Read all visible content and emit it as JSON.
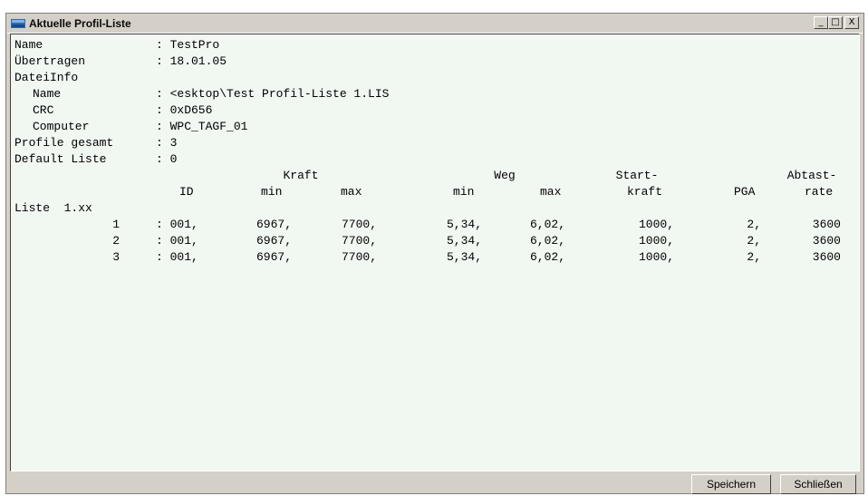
{
  "window": {
    "title": "Aktuelle Profil-Liste",
    "minimize": "_",
    "maximize": "□",
    "close": "X"
  },
  "info": {
    "name_label": "Name",
    "name_value": ": TestPro",
    "transfer_label": "Übertragen",
    "transfer_value": ": 18.01.05",
    "fileinfo_label": "DateiInfo",
    "file_name_label": "Name",
    "file_name_value": ": <esktop\\Test Profil-Liste 1.LIS",
    "crc_label": "CRC",
    "crc_value": ": 0xD656",
    "computer_label": "Computer",
    "computer_value": ": WPC_TAGF_01",
    "profiles_total_label": "Profile gesamt",
    "profiles_total_value": ": 3",
    "default_list_label": "Default Liste",
    "default_list_value": ": 0"
  },
  "table": {
    "group_kraft": "Kraft",
    "group_weg": "Weg",
    "group_start": "Start-",
    "group_abtast": "Abtast-",
    "h_id": "ID",
    "h_kraft_min": "min",
    "h_kraft_max": "max",
    "h_weg_min": "min",
    "h_weg_max": "max",
    "h_startkraft": "kraft",
    "h_pga": "PGA",
    "h_rate": "rate",
    "list_label": "Liste  1.xx",
    "rows": [
      {
        "num": "1",
        "id": ": 001,",
        "kmin": "6967,",
        "kmax": "7700,",
        "wmin": "5,34,",
        "wmax": "6,02,",
        "start": "1000,",
        "pga": "2,",
        "rate": "3600"
      },
      {
        "num": "2",
        "id": ": 001,",
        "kmin": "6967,",
        "kmax": "7700,",
        "wmin": "5,34,",
        "wmax": "6,02,",
        "start": "1000,",
        "pga": "2,",
        "rate": "3600"
      },
      {
        "num": "3",
        "id": ": 001,",
        "kmin": "6967,",
        "kmax": "7700,",
        "wmin": "5,34,",
        "wmax": "6,02,",
        "start": "1000,",
        "pga": "2,",
        "rate": "3600"
      }
    ]
  },
  "buttons": {
    "save": "Speichern",
    "close": "Schließen"
  }
}
